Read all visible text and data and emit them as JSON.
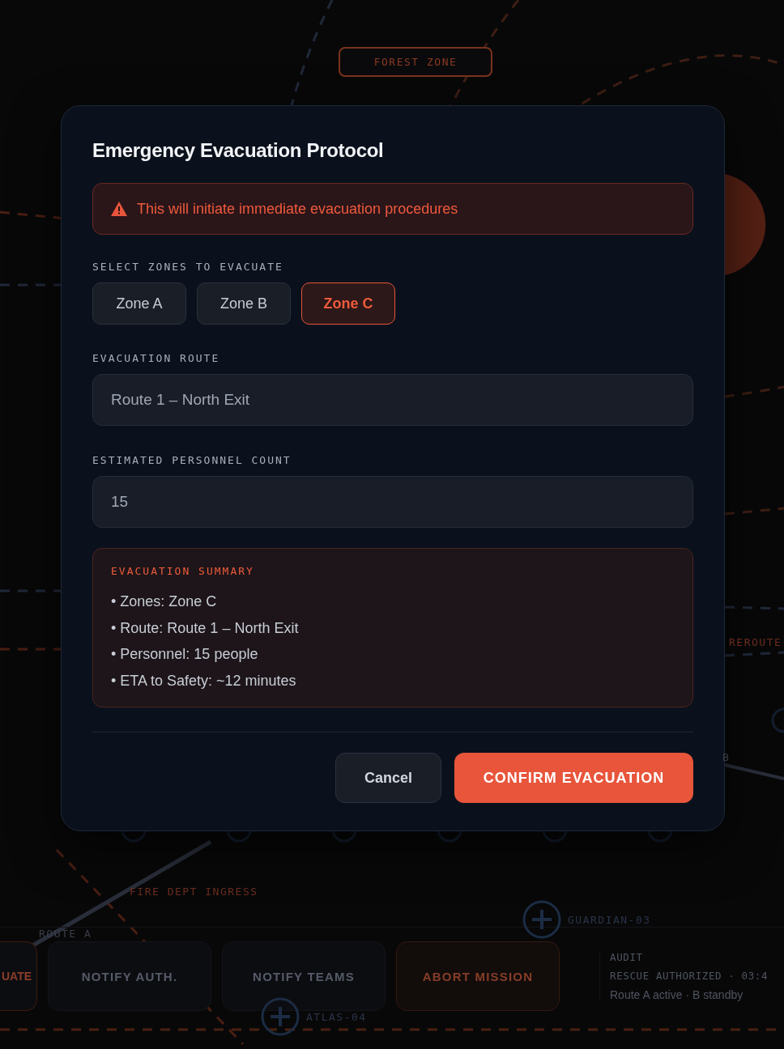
{
  "map": {
    "labels": [
      {
        "kind": "zone",
        "text": "FOREST ZONE"
      },
      {
        "kind": "route",
        "text": "REROUTE"
      },
      {
        "kind": "plain",
        "text": "B"
      },
      {
        "kind": "route",
        "text": "FIRE DEPT INGRESS"
      },
      {
        "kind": "unit",
        "text": "GUARDIAN-03"
      },
      {
        "kind": "plain",
        "text": "ROUTE A"
      },
      {
        "kind": "unit",
        "text": "ATLAS-04"
      }
    ]
  },
  "action_bar": {
    "buttons": [
      {
        "label": "UATE",
        "kind": "primary"
      },
      {
        "label": "NOTIFY AUTH.",
        "kind": "secondary"
      },
      {
        "label": "NOTIFY TEAMS",
        "kind": "secondary"
      },
      {
        "label": "ABORT MISSION",
        "kind": "danger"
      }
    ],
    "audit": {
      "title": "AUDIT",
      "entry": "RESCUE AUTHORIZED · 03:4",
      "note": "Route A active · B standby"
    }
  },
  "dialog": {
    "title": "Emergency Evacuation Protocol",
    "warning": "This will initiate immediate evacuation procedures",
    "zones_label": "SELECT ZONES TO EVACUATE",
    "zones": [
      {
        "label": "Zone A",
        "selected": false
      },
      {
        "label": "Zone B",
        "selected": false
      },
      {
        "label": "Zone C",
        "selected": true
      }
    ],
    "route_label": "EVACUATION ROUTE",
    "route": "Route 1 – North Exit",
    "count_label": "ESTIMATED PERSONNEL COUNT",
    "count": "15",
    "summary": {
      "title": "EVACUATION SUMMARY",
      "items": [
        "• Zones: Zone C",
        "• Route: Route 1 – North Exit",
        "• Personnel: 15 people",
        "• ETA to Safety: ~12 minutes"
      ]
    },
    "buttons": [
      {
        "label": "Cancel",
        "kind": "cancel"
      },
      {
        "label": "CONFIRM EVACUATION",
        "kind": "confirm"
      }
    ]
  }
}
